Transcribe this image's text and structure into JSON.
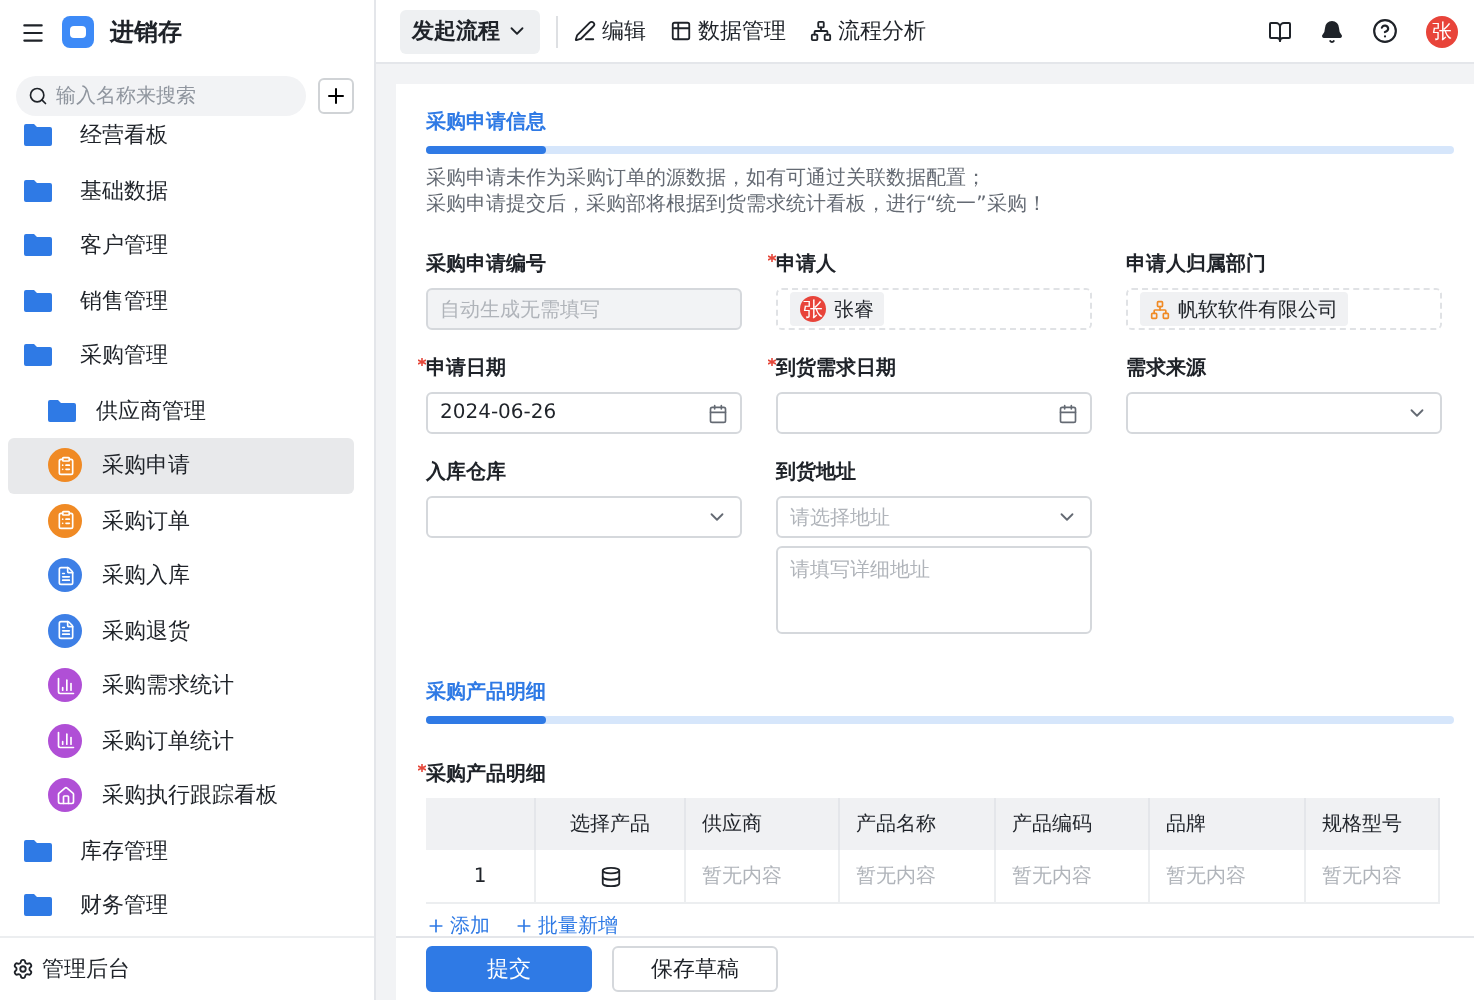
{
  "app": {
    "title": "进销存"
  },
  "search": {
    "placeholder": "输入名称来搜索"
  },
  "sidebar": {
    "items": [
      {
        "label": "经营看板",
        "kind": "folder",
        "selected": false
      },
      {
        "label": "基础数据",
        "kind": "folder",
        "selected": false
      },
      {
        "label": "客户管理",
        "kind": "folder",
        "selected": false
      },
      {
        "label": "销售管理",
        "kind": "folder",
        "selected": false
      },
      {
        "label": "采购管理",
        "kind": "folder",
        "selected": false,
        "children": [
          {
            "label": "供应商管理",
            "kind": "folder",
            "selected": false
          },
          {
            "label": "采购申请",
            "kind": "form",
            "selected": true
          },
          {
            "label": "采购订单",
            "kind": "form",
            "selected": false
          },
          {
            "label": "采购入库",
            "kind": "doc",
            "selected": false
          },
          {
            "label": "采购退货",
            "kind": "doc",
            "selected": false
          },
          {
            "label": "采购需求统计",
            "kind": "chart",
            "selected": false
          },
          {
            "label": "采购订单统计",
            "kind": "chart",
            "selected": false
          },
          {
            "label": "采购执行跟踪看板",
            "kind": "board",
            "selected": false
          }
        ]
      },
      {
        "label": "库存管理",
        "kind": "folder",
        "selected": false
      },
      {
        "label": "财务管理",
        "kind": "folder",
        "selected": false
      }
    ],
    "footer": "管理后台"
  },
  "toolbar": {
    "actions": [
      {
        "label": "发起流程",
        "kind": "dropdown"
      },
      {
        "label": "编辑",
        "kind": "edit"
      },
      {
        "label": "数据管理",
        "kind": "data"
      },
      {
        "label": "流程分析",
        "kind": "flow"
      }
    ],
    "avatar": "张"
  },
  "info_section": {
    "title": "采购申请信息",
    "description": [
      "采购申请未作为采购订单的源数据，如有可通过关联数据配置；",
      "采购申请提交后，采购部将根据到货需求统计看板，进行“统一”采购！"
    ],
    "fields": [
      {
        "label": "采购申请编号",
        "required": false,
        "kind": "text",
        "disabled": true,
        "placeholder": "自动生成无需填写"
      },
      {
        "label": "申请人",
        "required": true,
        "kind": "member",
        "avatar": "张",
        "value": "张睿"
      },
      {
        "label": "申请人归属部门",
        "required": false,
        "kind": "dept",
        "value": "帆软软件有限公司"
      },
      {
        "label": "申请日期",
        "required": true,
        "kind": "date",
        "value": "2024-06-26"
      },
      {
        "label": "到货需求日期",
        "required": true,
        "kind": "date"
      },
      {
        "label": "需求来源",
        "required": false,
        "kind": "select"
      },
      {
        "label": "入库仓库",
        "required": false,
        "kind": "select"
      },
      {
        "label": "到货地址",
        "required": false,
        "kind": "address",
        "placeholder": "请选择地址",
        "detail_placeholder": "请填写详细地址"
      }
    ]
  },
  "detail_section": {
    "title": "采购产品明细",
    "table_label": "采购产品明细",
    "required": true,
    "columns": [
      "",
      "选择产品",
      "供应商",
      "产品名称",
      "产品编码",
      "品牌",
      "规格型号"
    ],
    "rows": [
      {
        "cells": [
          "1",
          "",
          "暂无内容",
          "暂无内容",
          "暂无内容",
          "暂无内容",
          "暂无内容"
        ]
      }
    ],
    "actions": [
      "添加",
      "批量新增"
    ]
  },
  "footer_buttons": [
    {
      "label": "提交",
      "kind": "primary"
    },
    {
      "label": "保存草稿",
      "kind": "default"
    }
  ]
}
